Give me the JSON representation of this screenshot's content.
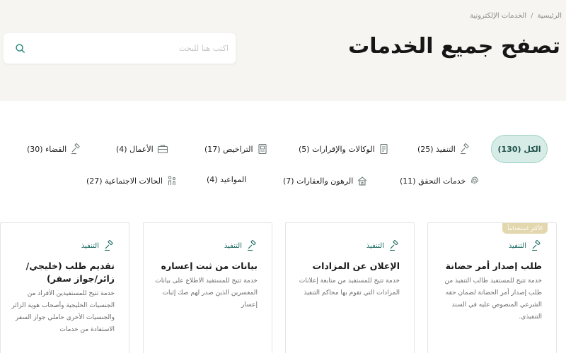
{
  "breadcrumb": {
    "home": "الرئيسية",
    "separator": "/",
    "current": "الخدمات الإلكترونية"
  },
  "page_title": "تصفح جميع الخدمات",
  "search": {
    "placeholder": "اكتب هنا للبحث",
    "icon": "search-icon"
  },
  "tabs": [
    {
      "label": "الكل (130)",
      "icon": "",
      "active": true
    },
    {
      "label": "التنفيذ (25)",
      "icon": "gavel-icon"
    },
    {
      "label": "الوكالات والإقرارات (5)",
      "icon": "document-icon"
    },
    {
      "label": "التراخيص (17)",
      "icon": "license-icon"
    },
    {
      "label": "الأعمال (4)",
      "icon": "briefcase-icon"
    },
    {
      "label": "القضاء (30)",
      "icon": "gavel-icon"
    },
    {
      "label": "خدمات التحقق (11)",
      "icon": "fingerprint-icon"
    },
    {
      "label": "الرهون والعقارات (7)",
      "icon": "mortgage-icon"
    },
    {
      "label": "المواعيد (4)",
      "icon": ""
    },
    {
      "label": "الحالات الاجتماعية (27)",
      "icon": "family-icon"
    }
  ],
  "cards": [
    {
      "badge": "الأكثر استخداماً",
      "category": "التنفيذ",
      "title": "طلب إصدار أمر حضانة",
      "description": "خدمة تتيح للمستفيد طالب التنفيذ من طلب إصدار أمر الحضانة لضمان حقه الشرعي المنصوص عليه في السند التنفيذي."
    },
    {
      "badge": "",
      "category": "التنفيذ",
      "title": "الإعلان عن المزادات",
      "description": "خدمة تتيح للمستفيد من متابعة إعلانات المزادات التي تقوم بها محاكم التنفيذ"
    },
    {
      "badge": "",
      "category": "التنفيذ",
      "title": "بيانات من ثبت إعساره",
      "description": "خدمة تتيح للمستفيد الاطلاع على بيانات المعسرين الذين صدر لهم صك إثبات إعسار"
    },
    {
      "badge": "",
      "category": "التنفيذ",
      "title": "تقديم طلب (خليجي/زائر/جواز سفر)",
      "description": "خدمة تتيح للمستفيدين الأفراد من الجنسيات الخليجية وأصحاب هوية الزائر والجنسيات الأخرى حاملي جواز السفر الاستفادة من خدمات"
    }
  ],
  "colors": {
    "accent": "#1e6b63",
    "active_tab_bg": "#d7ece7",
    "active_tab_border": "#9fd3c4",
    "badge": "#e3d7ae",
    "hero_bg": "#f6f5f1"
  }
}
